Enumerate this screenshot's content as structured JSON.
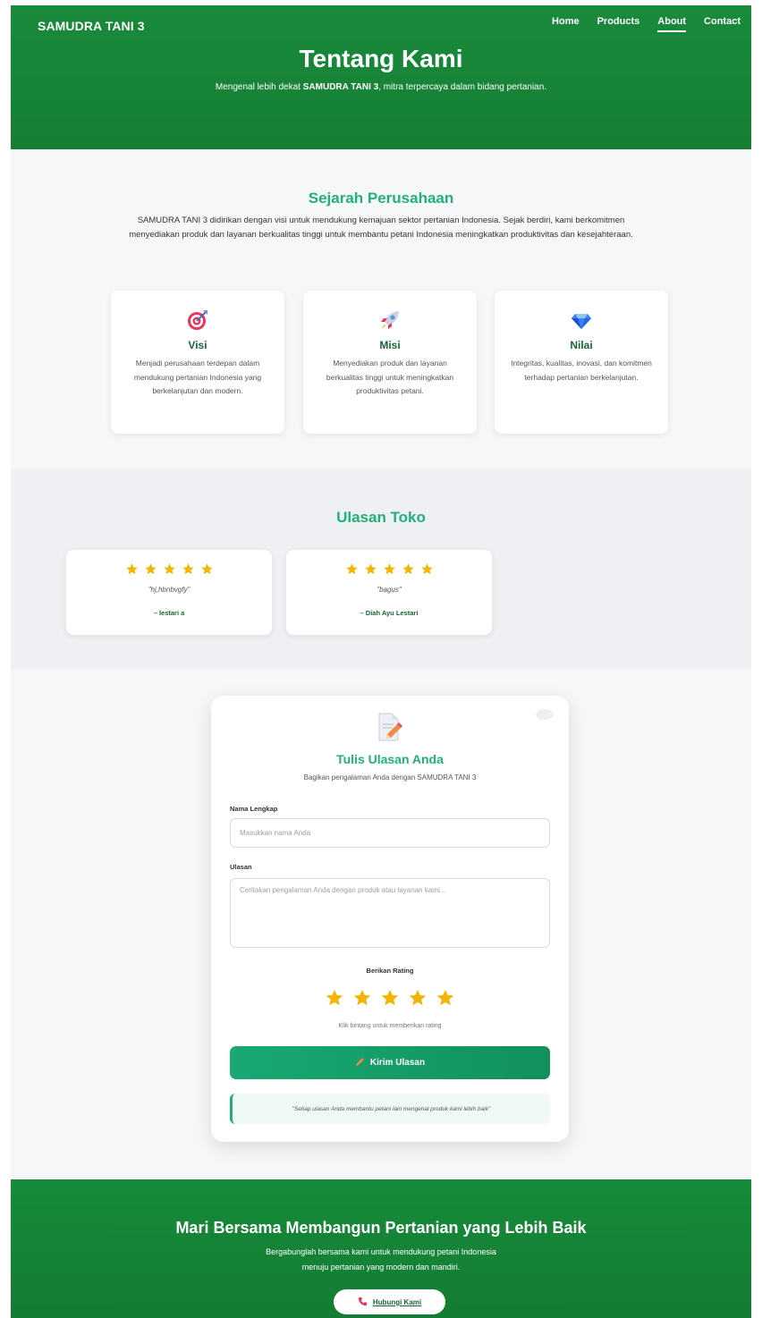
{
  "header": {
    "brand": "SAMUDRA TANI 3",
    "nav": [
      "Home",
      "Products",
      "About",
      "Contact"
    ],
    "active_nav": "About"
  },
  "hero": {
    "title": "Tentang Kami",
    "subtitle_pre": "Mengenal lebih dekat ",
    "subtitle_bold": "SAMUDRA TANI 3",
    "subtitle_post": ", mitra terpercaya dalam bidang pertanian."
  },
  "sejarah": {
    "title": "Sejarah Perusahaan",
    "text": "SAMUDRA TANI 3 didirikan dengan visi untuk mendukung kemajuan sektor pertanian Indonesia. Sejak berdiri, kami berkomitmen menyediakan produk dan layanan berkualitas tinggi untuk membantu petani Indonesia meningkatkan produktivitas dan kesejahteraan.",
    "cards": [
      {
        "icon": "target-icon",
        "title": "Visi",
        "text": "Menjadi perusahaan terdepan dalam mendukung pertanian Indonesia yang berkelanjutan dan modern."
      },
      {
        "icon": "rocket-icon",
        "title": "Misi",
        "text": "Menyediakan produk dan layanan berkualitas tinggi untuk meningkatkan produktivitas petani."
      },
      {
        "icon": "diamond-icon",
        "title": "Nilai",
        "text": "Integritas, kualitas, inovasi, dan komitmen terhadap pertanian berkelanjutan."
      }
    ]
  },
  "ulasan": {
    "title": "Ulasan Toko",
    "reviews": [
      {
        "rating": 5,
        "text": "\"hj,hbnbvgfy\"",
        "author": "– lestari a"
      },
      {
        "rating": 5,
        "text": "\"bagus\"",
        "author": "– Diah Ayu Lestari"
      }
    ]
  },
  "form": {
    "title": "Tulis Ulasan Anda",
    "subtitle": "Bagikan pengalaman Anda dengan SAMUDRA TANI 3",
    "name_label": "Nama Lengkap",
    "name_placeholder": "Masukkan nama Anda",
    "review_label": "Ulasan",
    "review_placeholder": "Ceritakan pengalaman Anda dengan produk atau layanan kami...",
    "rating_label": "Berikan Rating",
    "rating_value": 5,
    "rating_hint": "Klik bintang untuk memberikan rating",
    "submit_label": "Kirim Ulasan",
    "note": "\"Setiap ulasan Anda membantu petani lain mengenal produk kami lebih baik\""
  },
  "cta": {
    "title": "Mari Bersama Membangun Pertanian yang Lebih Baik",
    "text_line1": "Bergabunglah bersama kami untuk mendukung petani Indonesia",
    "text_line2": "menuju pertanian yang modern dan mandiri.",
    "button_label": "Hubungi Kami"
  },
  "colors": {
    "primary_green": "#157f34",
    "accent_teal": "#22b07a",
    "star": "#f4b400"
  }
}
